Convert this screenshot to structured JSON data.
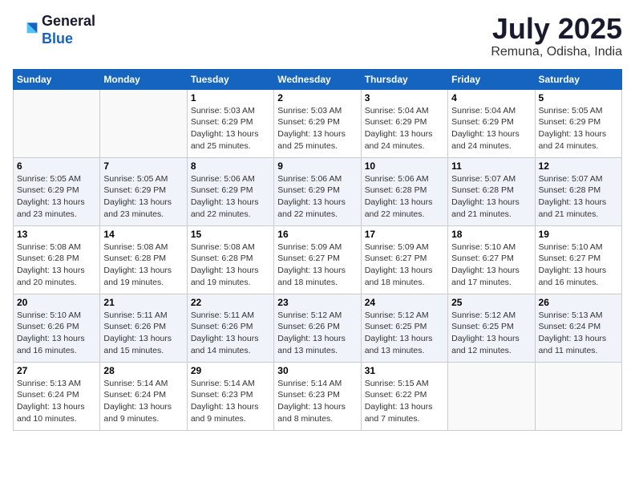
{
  "header": {
    "logo_general": "General",
    "logo_blue": "Blue",
    "month_year": "July 2025",
    "location": "Remuna, Odisha, India"
  },
  "weekdays": [
    "Sunday",
    "Monday",
    "Tuesday",
    "Wednesday",
    "Thursday",
    "Friday",
    "Saturday"
  ],
  "weeks": [
    [
      {
        "day": "",
        "detail": ""
      },
      {
        "day": "",
        "detail": ""
      },
      {
        "day": "1",
        "detail": "Sunrise: 5:03 AM\nSunset: 6:29 PM\nDaylight: 13 hours\nand 25 minutes."
      },
      {
        "day": "2",
        "detail": "Sunrise: 5:03 AM\nSunset: 6:29 PM\nDaylight: 13 hours\nand 25 minutes."
      },
      {
        "day": "3",
        "detail": "Sunrise: 5:04 AM\nSunset: 6:29 PM\nDaylight: 13 hours\nand 24 minutes."
      },
      {
        "day": "4",
        "detail": "Sunrise: 5:04 AM\nSunset: 6:29 PM\nDaylight: 13 hours\nand 24 minutes."
      },
      {
        "day": "5",
        "detail": "Sunrise: 5:05 AM\nSunset: 6:29 PM\nDaylight: 13 hours\nand 24 minutes."
      }
    ],
    [
      {
        "day": "6",
        "detail": "Sunrise: 5:05 AM\nSunset: 6:29 PM\nDaylight: 13 hours\nand 23 minutes."
      },
      {
        "day": "7",
        "detail": "Sunrise: 5:05 AM\nSunset: 6:29 PM\nDaylight: 13 hours\nand 23 minutes."
      },
      {
        "day": "8",
        "detail": "Sunrise: 5:06 AM\nSunset: 6:29 PM\nDaylight: 13 hours\nand 22 minutes."
      },
      {
        "day": "9",
        "detail": "Sunrise: 5:06 AM\nSunset: 6:29 PM\nDaylight: 13 hours\nand 22 minutes."
      },
      {
        "day": "10",
        "detail": "Sunrise: 5:06 AM\nSunset: 6:28 PM\nDaylight: 13 hours\nand 22 minutes."
      },
      {
        "day": "11",
        "detail": "Sunrise: 5:07 AM\nSunset: 6:28 PM\nDaylight: 13 hours\nand 21 minutes."
      },
      {
        "day": "12",
        "detail": "Sunrise: 5:07 AM\nSunset: 6:28 PM\nDaylight: 13 hours\nand 21 minutes."
      }
    ],
    [
      {
        "day": "13",
        "detail": "Sunrise: 5:08 AM\nSunset: 6:28 PM\nDaylight: 13 hours\nand 20 minutes."
      },
      {
        "day": "14",
        "detail": "Sunrise: 5:08 AM\nSunset: 6:28 PM\nDaylight: 13 hours\nand 19 minutes."
      },
      {
        "day": "15",
        "detail": "Sunrise: 5:08 AM\nSunset: 6:28 PM\nDaylight: 13 hours\nand 19 minutes."
      },
      {
        "day": "16",
        "detail": "Sunrise: 5:09 AM\nSunset: 6:27 PM\nDaylight: 13 hours\nand 18 minutes."
      },
      {
        "day": "17",
        "detail": "Sunrise: 5:09 AM\nSunset: 6:27 PM\nDaylight: 13 hours\nand 18 minutes."
      },
      {
        "day": "18",
        "detail": "Sunrise: 5:10 AM\nSunset: 6:27 PM\nDaylight: 13 hours\nand 17 minutes."
      },
      {
        "day": "19",
        "detail": "Sunrise: 5:10 AM\nSunset: 6:27 PM\nDaylight: 13 hours\nand 16 minutes."
      }
    ],
    [
      {
        "day": "20",
        "detail": "Sunrise: 5:10 AM\nSunset: 6:26 PM\nDaylight: 13 hours\nand 16 minutes."
      },
      {
        "day": "21",
        "detail": "Sunrise: 5:11 AM\nSunset: 6:26 PM\nDaylight: 13 hours\nand 15 minutes."
      },
      {
        "day": "22",
        "detail": "Sunrise: 5:11 AM\nSunset: 6:26 PM\nDaylight: 13 hours\nand 14 minutes."
      },
      {
        "day": "23",
        "detail": "Sunrise: 5:12 AM\nSunset: 6:26 PM\nDaylight: 13 hours\nand 13 minutes."
      },
      {
        "day": "24",
        "detail": "Sunrise: 5:12 AM\nSunset: 6:25 PM\nDaylight: 13 hours\nand 13 minutes."
      },
      {
        "day": "25",
        "detail": "Sunrise: 5:12 AM\nSunset: 6:25 PM\nDaylight: 13 hours\nand 12 minutes."
      },
      {
        "day": "26",
        "detail": "Sunrise: 5:13 AM\nSunset: 6:24 PM\nDaylight: 13 hours\nand 11 minutes."
      }
    ],
    [
      {
        "day": "27",
        "detail": "Sunrise: 5:13 AM\nSunset: 6:24 PM\nDaylight: 13 hours\nand 10 minutes."
      },
      {
        "day": "28",
        "detail": "Sunrise: 5:14 AM\nSunset: 6:24 PM\nDaylight: 13 hours\nand 9 minutes."
      },
      {
        "day": "29",
        "detail": "Sunrise: 5:14 AM\nSunset: 6:23 PM\nDaylight: 13 hours\nand 9 minutes."
      },
      {
        "day": "30",
        "detail": "Sunrise: 5:14 AM\nSunset: 6:23 PM\nDaylight: 13 hours\nand 8 minutes."
      },
      {
        "day": "31",
        "detail": "Sunrise: 5:15 AM\nSunset: 6:22 PM\nDaylight: 13 hours\nand 7 minutes."
      },
      {
        "day": "",
        "detail": ""
      },
      {
        "day": "",
        "detail": ""
      }
    ]
  ]
}
